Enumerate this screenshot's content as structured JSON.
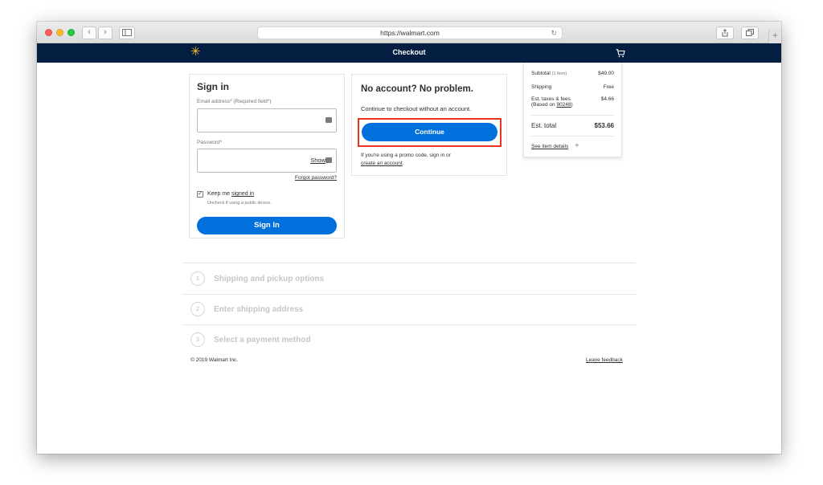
{
  "browser": {
    "url": "https://walmart.com",
    "back_label": "‹",
    "forward_label": "›"
  },
  "header": {
    "title": "Checkout",
    "logo_glyph": "✳",
    "cart_icon": "cart-icon",
    "background": "#041e42",
    "logo_color": "#ffc220"
  },
  "signin": {
    "heading": "Sign in",
    "email_label": "Email address* (Required field*)",
    "password_label": "Password*",
    "show_label": "Show",
    "forgot_label": "Forgot password?",
    "keep_prefix": "Keep me ",
    "keep_link": "signed in",
    "keep_hint": "Uncheck if using a public device.",
    "checkbox_mark": "✓",
    "button_label": "Sign In"
  },
  "guest": {
    "heading": "No account? No problem.",
    "text": "Continue to checkout without an account.",
    "button_label": "Continue",
    "promo_line1": "If you're using a promo code, sign in or",
    "promo_link": "create an account",
    "promo_end": "."
  },
  "summary": {
    "subtotal_label": "Subtotal",
    "subtotal_items": "(1 item)",
    "subtotal_value": "$49.00",
    "shipping_label": "Shipping",
    "shipping_value": "Free",
    "taxes_label": "Est. taxes & fees",
    "taxes_based": "(Based on ",
    "taxes_zip": "90248",
    "taxes_close": ")",
    "taxes_value": "$4.66",
    "total_label": "Est. total",
    "total_value": "$53.66",
    "details_label": "See item details",
    "details_plus": "+"
  },
  "steps": [
    {
      "num": "1",
      "label": "Shipping and pickup options"
    },
    {
      "num": "2",
      "label": "Enter shipping address"
    },
    {
      "num": "3",
      "label": "Select a payment method"
    }
  ],
  "footer": {
    "copyright": "© 2019 Walmart Inc.",
    "feedback": "Leave feedback"
  },
  "colors": {
    "accent_blue": "#0071dc",
    "highlight_red": "#e8351f"
  }
}
